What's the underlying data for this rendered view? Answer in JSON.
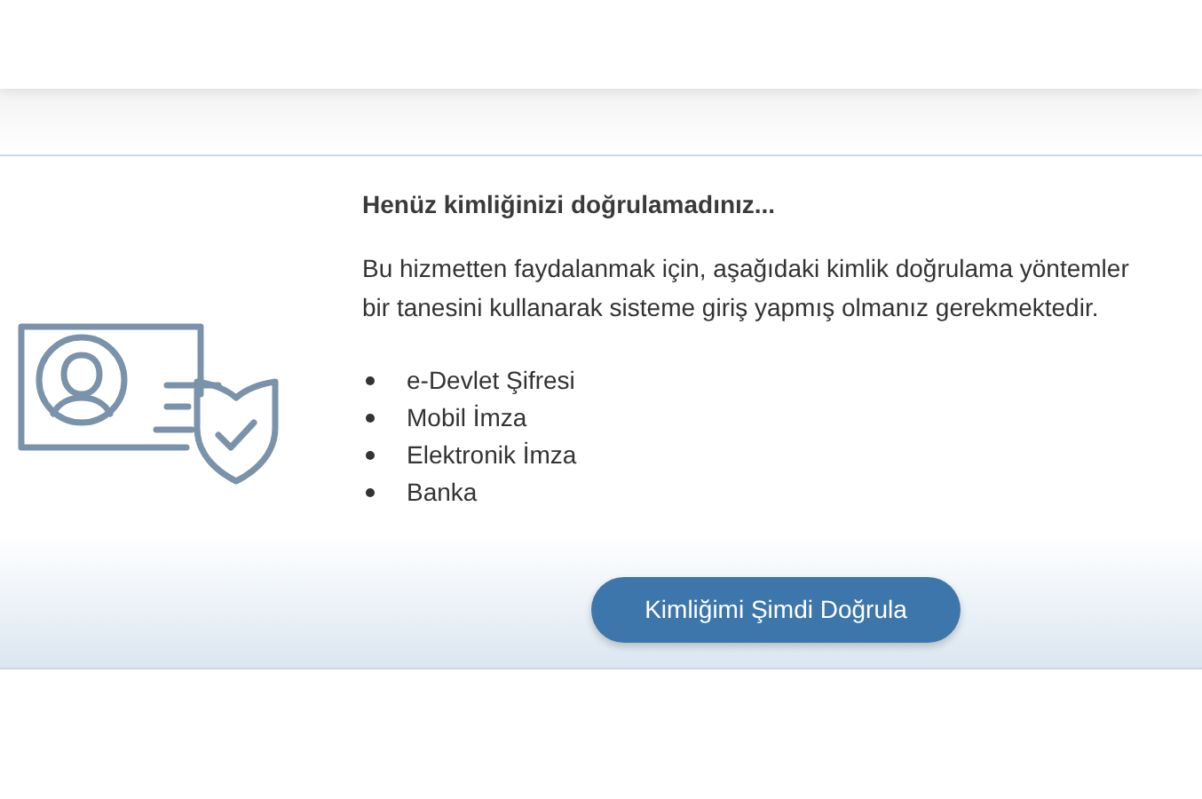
{
  "notice": {
    "title": "Henüz kimliğinizi doğrulamadınız...",
    "message_lines": [
      "Bu hizmetten faydalanmak için, aşağıdaki kimlik doğrulama yöntemler",
      "bir tanesini kullanarak sisteme giriş yapmış olmanız gerekmektedir."
    ],
    "methods": [
      "e-Devlet Şifresi",
      "Mobil İmza",
      "Elektronik İmza",
      "Banka"
    ],
    "button": "Kimliğimi Şimdi Doğrula"
  }
}
